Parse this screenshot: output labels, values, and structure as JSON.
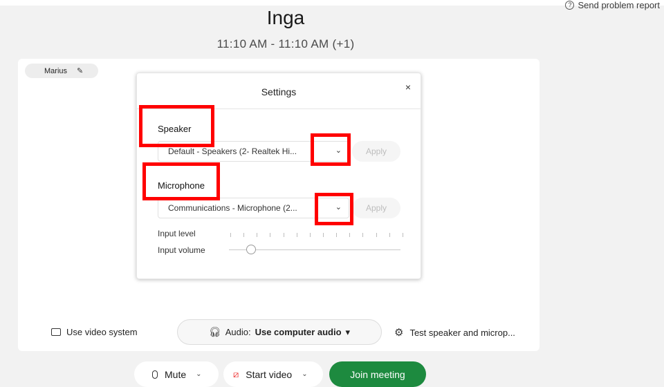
{
  "header": {
    "problem_report": "Send problem report",
    "title": "Inga",
    "time_range": "11:10 AM - 11:10 AM (+1)"
  },
  "preview": {
    "participant_name": "Marius"
  },
  "settings_dialog": {
    "title": "Settings",
    "close_glyph": "×",
    "speaker": {
      "label": "Speaker",
      "selected": "Default - Speakers (2- Realtek Hi...",
      "apply": "Apply"
    },
    "microphone": {
      "label": "Microphone",
      "selected": "Communications - Microphone (2...",
      "apply": "Apply"
    },
    "input_level_label": "Input level",
    "input_volume_label": "Input volume",
    "input_volume_fraction": 0.13
  },
  "controls": {
    "use_video_system": "Use video system",
    "audio_prefix": "Audio:",
    "audio_value": "Use computer audio",
    "test_speaker": "Test speaker and microp..."
  },
  "bottom_bar": {
    "mute_label": "Mute",
    "start_video_label": "Start video",
    "join_label": "Join meeting"
  },
  "colors": {
    "highlight": "#ff0000",
    "join_button": "#1d8a3f",
    "video_off_icon": "#e22222"
  },
  "icons": {
    "help": "question-circle-icon",
    "edit": "pencil-icon",
    "close": "close-icon",
    "dropdown": "chevron-down-icon",
    "video_system": "cast-icon",
    "headset": "headset-icon",
    "settings": "gear-icon",
    "microphone": "microphone-icon",
    "video_off": "video-off-icon"
  }
}
